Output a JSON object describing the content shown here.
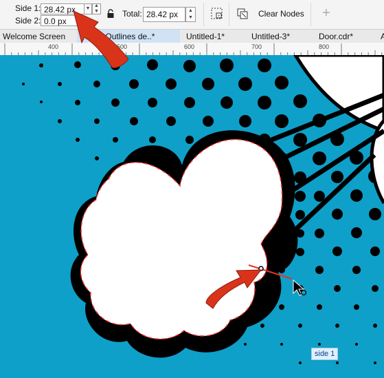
{
  "toolbar": {
    "side1_label": "Side 1:",
    "side1_value": "28.42 px",
    "side2_label": "Side 2:",
    "side2_value": "0.0 px",
    "total_label": "Total:",
    "total_value": "28.42 px",
    "clear_nodes_label": "Clear Nodes",
    "add_symbol": "+"
  },
  "tabs": [
    {
      "label": "Welcome Screen"
    },
    {
      "label": "Vector Outlines de..*",
      "active": true
    },
    {
      "label": "Untitled-1*"
    },
    {
      "label": "Untitled-3*"
    },
    {
      "label": "Door.cdr*"
    },
    {
      "label": "A"
    }
  ],
  "ruler": {
    "labels": [
      "400",
      "500",
      "600",
      "700",
      "800"
    ]
  },
  "canvas": {
    "tooltip": "side 1",
    "background_color": "#0ea0c8"
  },
  "colors": {
    "accent_arrow": "#d9341a",
    "dashed_outline": "#e23232"
  },
  "icons": [
    "lock-icon",
    "segment-snap-icon",
    "clear-nodes-icon",
    "add-icon",
    "dropdown-arrow-icon",
    "pointer-cursor-icon"
  ]
}
